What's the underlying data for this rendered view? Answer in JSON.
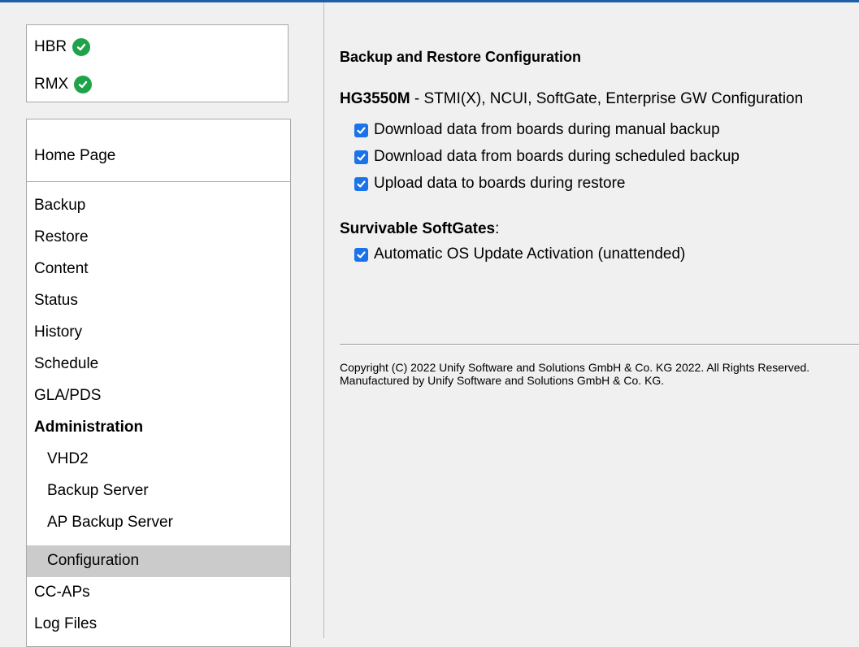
{
  "status": {
    "items": [
      {
        "label": "HBR",
        "icon": "check-circle-icon",
        "color": "#1ea34a"
      },
      {
        "label": "RMX",
        "icon": "check-circle-icon",
        "color": "#1ea34a"
      }
    ]
  },
  "nav": {
    "home": "Home Page",
    "items": [
      {
        "label": "Backup"
      },
      {
        "label": "Restore"
      },
      {
        "label": "Content"
      },
      {
        "label": "Status"
      },
      {
        "label": "History"
      },
      {
        "label": "Schedule"
      },
      {
        "label": "GLA/PDS"
      },
      {
        "label": "Administration"
      },
      {
        "label": "VHD2"
      },
      {
        "label": "Backup Server"
      },
      {
        "label": "AP Backup Server"
      },
      {
        "label": "Configuration"
      },
      {
        "label": "CC-APs"
      },
      {
        "label": "Log Files"
      }
    ],
    "selected": "Configuration"
  },
  "main": {
    "title": "Backup and Restore Configuration",
    "model": "HG3550M",
    "model_desc": " - STMI(X), NCUI, SoftGate, Enterprise GW Configuration",
    "options": [
      {
        "label": "Download data from boards during manual backup",
        "checked": true
      },
      {
        "label": "Download data from boards during scheduled backup",
        "checked": true
      },
      {
        "label": "Upload data to boards during restore",
        "checked": true
      }
    ],
    "survivable_title": "Survivable SoftGates",
    "survivable_colon": ":",
    "survivable_options": [
      {
        "label": "Automatic OS Update Activation (unattended)",
        "checked": true
      }
    ],
    "copyright_line1": "Copyright (C) 2022 Unify Software and Solutions GmbH & Co. KG 2022. All Rights Reserved.",
    "copyright_line2": "Manufactured by Unify Software and Solutions GmbH & Co. KG."
  },
  "colors": {
    "accent": "#1f5fa8",
    "checkbox": "#1a73e8",
    "status_ok": "#1ea34a",
    "selected_bg": "#cbcbcb"
  }
}
